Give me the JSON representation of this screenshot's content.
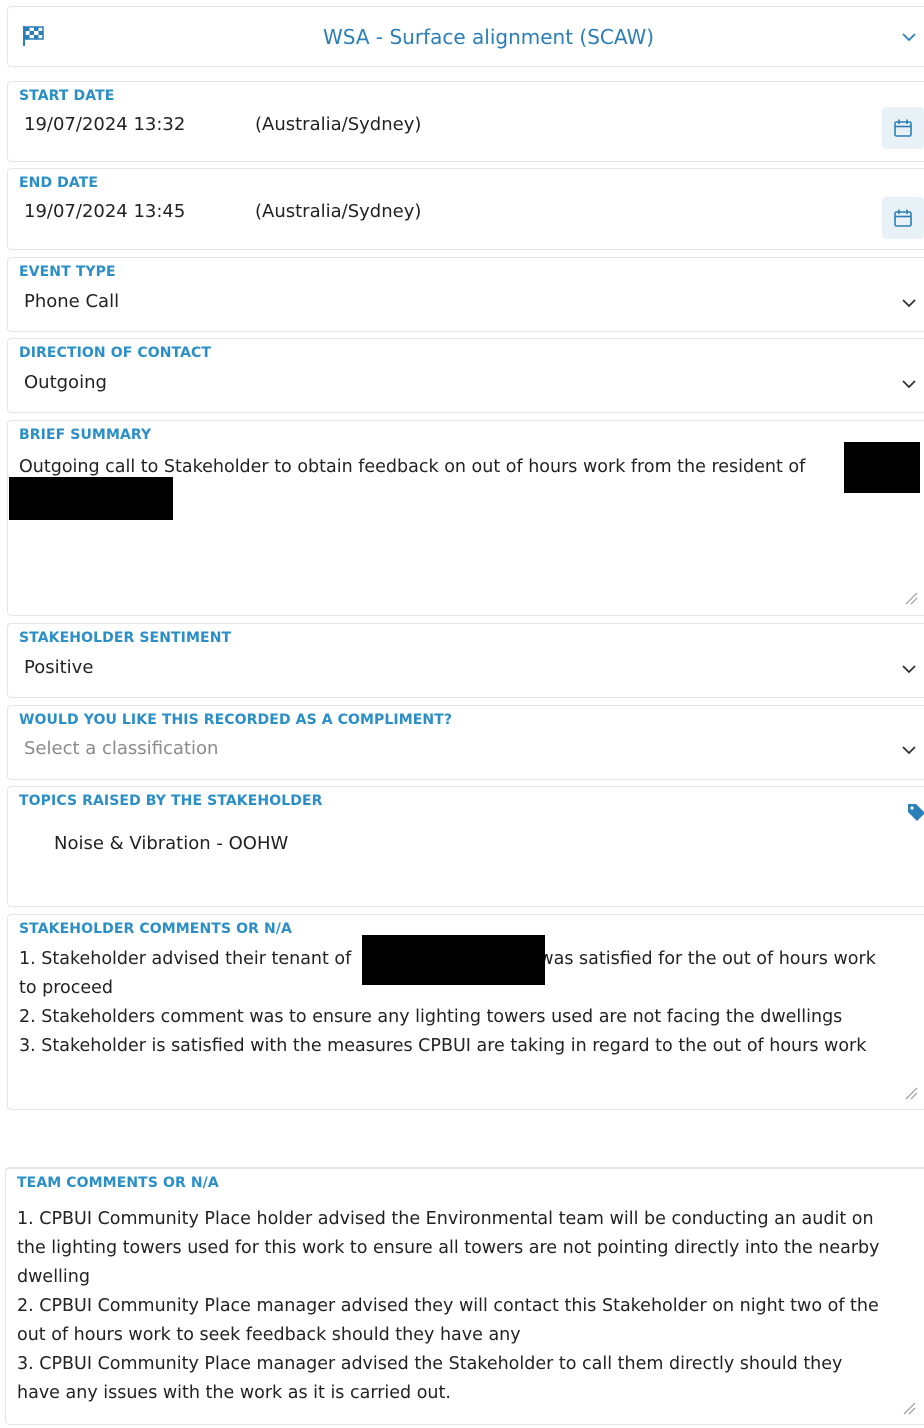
{
  "header": {
    "title": "WSA - Surface alignment (SCAW)",
    "icon": "flag-icon"
  },
  "start_date": {
    "label": "START DATE",
    "value": "19/07/2024 13:32",
    "timezone": "(Australia/Sydney)"
  },
  "end_date": {
    "label": "END DATE",
    "value": "19/07/2024 13:45",
    "timezone": "(Australia/Sydney)"
  },
  "event_type": {
    "label": "EVENT TYPE",
    "value": "Phone Call"
  },
  "direction": {
    "label": "DIRECTION OF CONTACT",
    "value": "Outgoing"
  },
  "summary": {
    "label": "BRIEF SUMMARY",
    "text": "Outgoing call to Stakeholder to obtain feedback on out of hours work from the resident of"
  },
  "sentiment": {
    "label": "STAKEHOLDER SENTIMENT",
    "value": "Positive"
  },
  "compliment": {
    "label": "WOULD YOU LIKE THIS RECORDED AS A COMPLIMENT?",
    "placeholder": "Select a classification"
  },
  "topics": {
    "label": "TOPICS RAISED BY THE STAKEHOLDER",
    "items": [
      "Noise & Vibration - OOHW"
    ]
  },
  "stakeholder_comments": {
    "label": "STAKEHOLDER COMMENTS OR N/A",
    "line1a": "1. Stakeholder advised their tenant of",
    "line1b": "was satisfied for the out of hours work",
    "line1c": "to proceed",
    "line2": "2. Stakeholders comment was to ensure any lighting towers used are not facing the dwellings",
    "line3": "3. Stakeholder is satisfied with the measures CPBUI are taking in regard to the out of hours work"
  },
  "team_comments": {
    "label": "TEAM COMMENTS OR N/A",
    "line1a": "1. CPBUI Community Place holder advised the Environmental team will be conducting an audit on",
    "line1b": "the lighting towers used for this work to ensure all towers are not pointing directly into the nearby",
    "line1c": "dwelling",
    "line2a": "2. CPBUI Community Place manager advised they will contact this Stakeholder on night two of the",
    "line2b": "out of hours work to seek feedback should they have any",
    "line3a": "3. CPBUI Community Place manager advised the Stakeholder to call them directly should they",
    "line3b": "have any issues with the work as it is carried out."
  },
  "colors": {
    "label": "#2a8fc7",
    "border": "#e2e6ea",
    "calendar_bg": "#e8f1f6",
    "chevron": "#2a7fb8"
  }
}
